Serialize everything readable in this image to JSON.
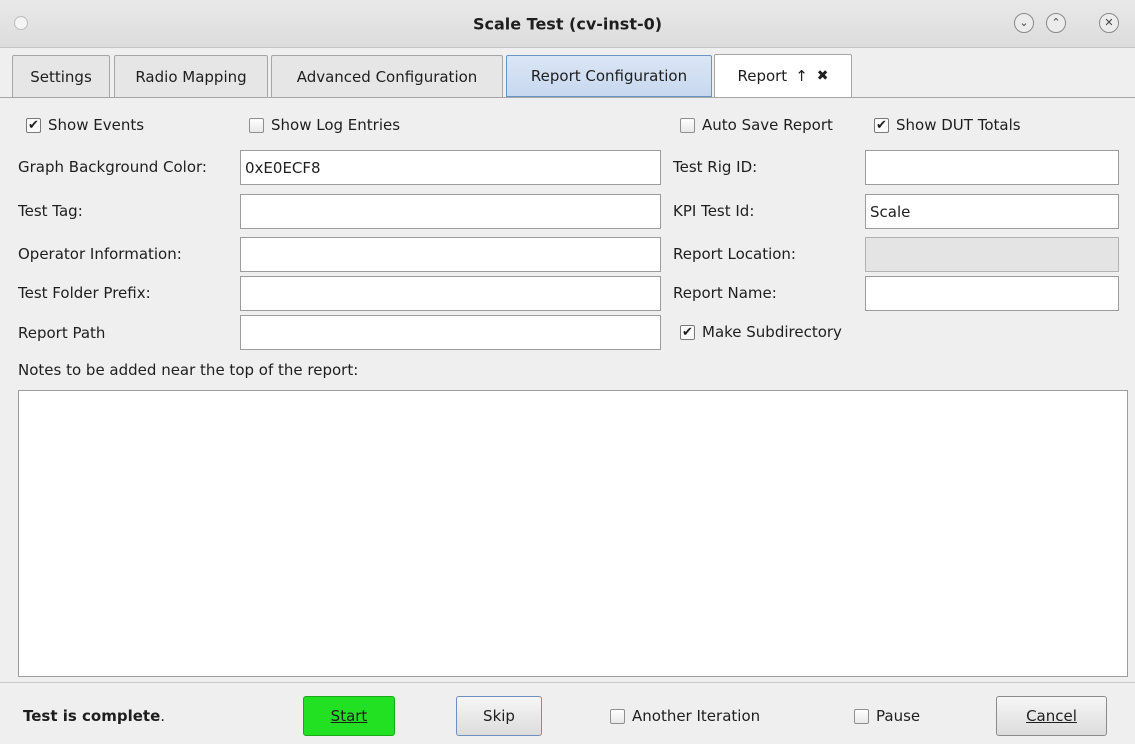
{
  "window": {
    "title": "Scale Test  (cv-inst-0)",
    "buttons": {
      "minimize": "⌄",
      "maximize": "⌃",
      "close": "✕"
    }
  },
  "tabs": [
    {
      "label": "Settings"
    },
    {
      "label": "Radio Mapping"
    },
    {
      "label": "Advanced Configuration"
    },
    {
      "label": "Report Configuration"
    },
    {
      "label": "Report",
      "arrow": "↑",
      "close": "✖"
    }
  ],
  "options": {
    "show_events": {
      "label": "Show Events",
      "checked": true
    },
    "show_log_entries": {
      "label": "Show Log Entries",
      "checked": false
    },
    "auto_save_report": {
      "label": "Auto Save Report",
      "checked": false
    },
    "show_dut_totals": {
      "label": "Show DUT Totals",
      "checked": true
    },
    "make_subdirectory": {
      "label": "Make Subdirectory",
      "checked": true
    }
  },
  "form": {
    "graph_bg_color": {
      "label": "Graph Background Color:",
      "value": "0xE0ECF8"
    },
    "test_tag": {
      "label": "Test Tag:",
      "value": ""
    },
    "operator_info": {
      "label": "Operator Information:",
      "value": ""
    },
    "test_folder_prefix": {
      "label": "Test Folder Prefix:",
      "value": ""
    },
    "report_path": {
      "label": "Report Path",
      "value": ""
    },
    "test_rig_id": {
      "label": "Test Rig ID:",
      "value": ""
    },
    "kpi_test_id": {
      "label": "KPI Test Id:",
      "value": "Scale"
    },
    "report_location": {
      "label": "Report Location:",
      "value": ""
    },
    "report_name": {
      "label": "Report Name:",
      "value": ""
    }
  },
  "notes": {
    "label": "Notes to be added near the top of the report:",
    "value": ""
  },
  "footer": {
    "status": "Test is complete",
    "status_suffix": ".",
    "start_label": "Start",
    "skip_label": "Skip",
    "another_iteration": {
      "label": "Another Iteration",
      "checked": false
    },
    "pause": {
      "label": "Pause",
      "checked": false
    },
    "cancel_label": "Cancel"
  },
  "colors": {
    "start_button": "#22e022",
    "selected_tab": "#c7d8ef"
  }
}
